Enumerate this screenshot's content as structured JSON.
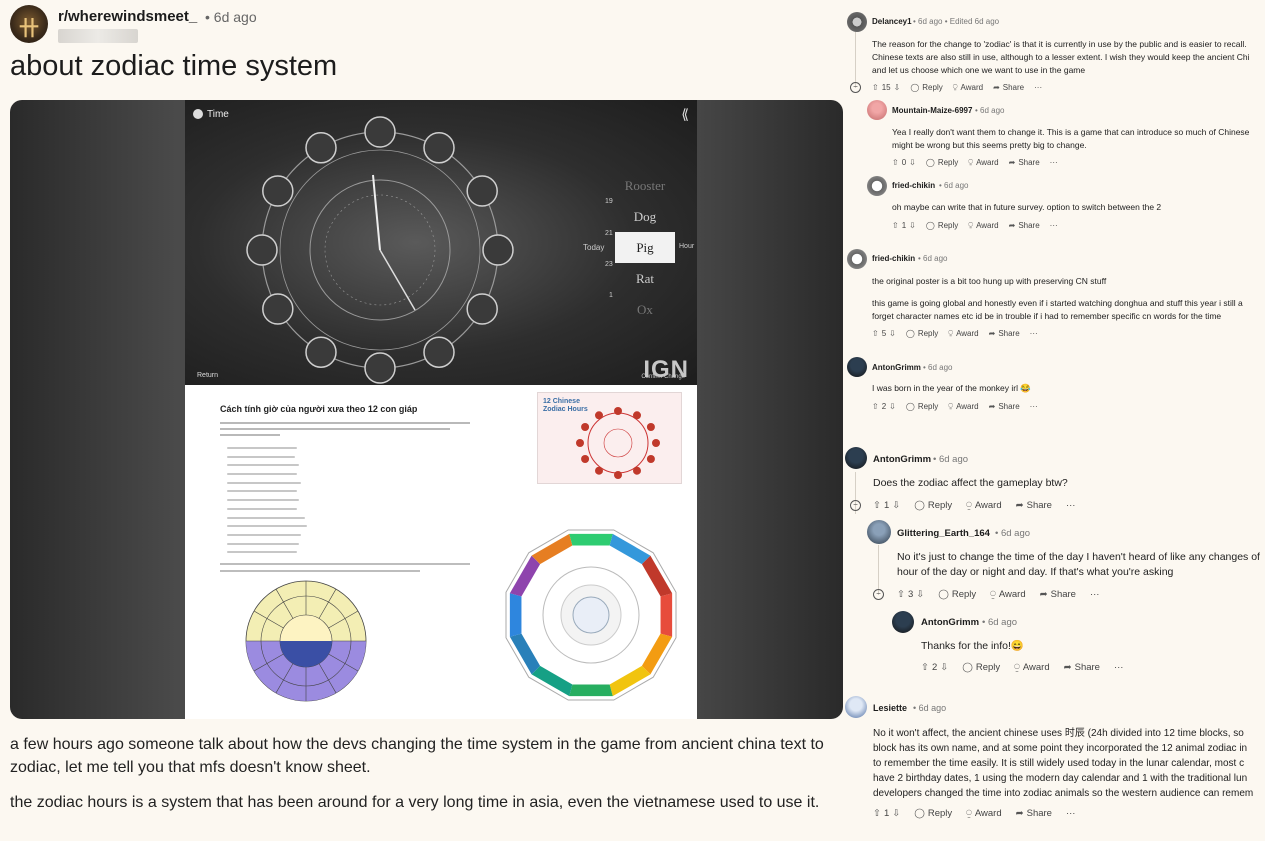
{
  "post": {
    "subreddit": "r/wherewindsmeet_",
    "time": "• 6d ago",
    "title": "about zodiac time system",
    "body": [
      "a few hours ago someone talk about how the devs changing the time system in the game from ancient china text to",
      "zodiac, let me tell you that mfs doesn't know sheet.",
      "the zodiac hours is a system that has been around for a very long time in asia, even the vietnamese used to use it."
    ],
    "image": {
      "game_title": "Time",
      "return_label": "Return",
      "watermark": "IGN",
      "confirm_label": "Confirm Change",
      "today_label": "Today",
      "hour_label": "Hour",
      "zodiac_options": [
        "Rooster",
        "Dog",
        "Pig",
        "Rat",
        "Ox"
      ],
      "selected_option": "Pig",
      "option_numbers": [
        "19",
        "21",
        "23",
        "1"
      ],
      "doc_title": "Cách tính giờ của người xưa theo 12 con giáp",
      "card_title_1": "12 Chinese",
      "card_title_2": "Zodiac Hours"
    }
  },
  "comments": [
    {
      "author": "Delancey1",
      "meta": "• 6d ago • Edited 6d ago",
      "lines": [
        "The reason for the change to 'zodiac' is that it is currently in use by the public and is easier to recall.",
        "Chinese texts are also still in use, although to a lesser extent. I wish they would keep the ancient Chi",
        "and let us choose which one we want to use in the game"
      ],
      "votes": "15"
    },
    {
      "author": "Mountain-Maize-6997",
      "meta": "• 6d ago",
      "lines": [
        "Yea I really don't want them to change it. This is a game that can introduce so much of Chinese",
        "might be wrong but this seems pretty big to change."
      ],
      "votes": "0"
    },
    {
      "author": "fried-chikin",
      "meta": "• 6d ago",
      "lines": [
        "oh maybe can write that in future survey. option to switch between the 2"
      ],
      "votes": "1"
    },
    {
      "author": "fried-chikin",
      "meta": "• 6d ago",
      "lines": [
        "the original poster is a bit too hung up with preserving CN stuff",
        "",
        "this game is going global and honestly even if i started watching donghua and stuff this year i still a",
        "forget character names etc id be in trouble if i had to remember specific cn words for the time"
      ],
      "votes": "5"
    },
    {
      "author": "AntonGrimm",
      "meta": "• 6d ago",
      "lines": [
        "I was born in the year of the monkey irl 😂"
      ],
      "votes": "2"
    },
    {
      "author": "AntonGrimm",
      "meta": "• 6d ago",
      "lines": [
        "Does the zodiac affect the gameplay btw?"
      ],
      "votes": "1"
    },
    {
      "author": "Glittering_Earth_164",
      "meta": "• 6d ago",
      "lines": [
        "No it's just to change the time of the day I haven't heard of like any changes of",
        "hour of the day or night and day. If that's what you're asking"
      ],
      "votes": "3"
    },
    {
      "author": "AntonGrimm",
      "meta": "• 6d ago",
      "lines": [
        "Thanks for the info!😄"
      ],
      "votes": "2"
    },
    {
      "author": "Lesiette",
      "meta": "• 6d ago",
      "lines": [
        "No it won't affect, the ancient chinese uses 时辰 (24h divided into 12 time blocks, so",
        "block has its own name, and at some point they incorporated the 12 animal zodiac in",
        "to remember the time easily. It is still widely used today in the lunar calendar, most c",
        "have 2 birthday dates, 1 using the modern day calendar and 1 with the traditional lun",
        "developers changed the time into zodiac animals so the western audience can remem"
      ],
      "votes": "1"
    }
  ],
  "actions": {
    "reply": "Reply",
    "award": "Award",
    "share": "Share",
    "more": "···"
  },
  "colors": {
    "background": "#fcf8f1",
    "text": "#1c1c1c",
    "muted": "#777777"
  }
}
